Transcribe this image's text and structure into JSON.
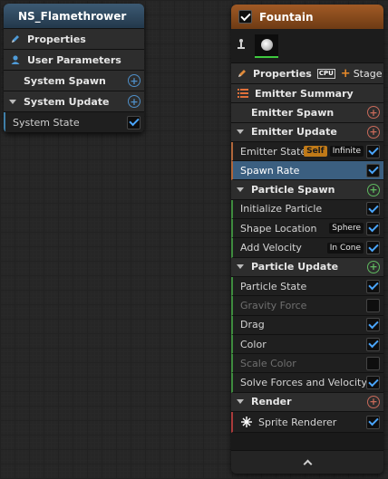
{
  "system_node": {
    "title": "NS_Flamethrower",
    "rows": {
      "properties": "Properties",
      "user_parameters": "User Parameters",
      "system_spawn": "System Spawn",
      "system_update": "System Update",
      "system_state": "System State"
    }
  },
  "emitter_node": {
    "title": "Fountain",
    "enabled": true,
    "properties_label": "Properties",
    "sim_target": "CPU",
    "stage_label": "Stage",
    "emitter_summary": "Emitter Summary",
    "emitter_spawn": "Emitter Spawn",
    "emitter_update": "Emitter Update",
    "emitter_state": {
      "label": "Emitter State",
      "tag1": "Self",
      "tag2": "Infinite",
      "checked": true
    },
    "spawn_rate": {
      "label": "Spawn Rate",
      "checked": true,
      "selected": true
    },
    "particle_spawn": "Particle Spawn",
    "initialize_particle": {
      "label": "Initialize Particle",
      "checked": true
    },
    "shape_location": {
      "label": "Shape Location",
      "tag": "Sphere",
      "checked": true
    },
    "add_velocity": {
      "label": "Add Velocity",
      "tag": "In Cone",
      "checked": true
    },
    "particle_update": "Particle Update",
    "particle_state": {
      "label": "Particle State",
      "checked": true
    },
    "gravity_force": {
      "label": "Gravity Force",
      "checked": false
    },
    "drag": {
      "label": "Drag",
      "checked": true
    },
    "color": {
      "label": "Color",
      "checked": true
    },
    "scale_color": {
      "label": "Scale Color",
      "checked": false
    },
    "solve_forces": {
      "label": "Solve Forces and Velocity",
      "checked": true
    },
    "render": "Render",
    "sprite_renderer": {
      "label": "Sprite Renderer",
      "checked": true
    }
  },
  "colors": {
    "system_header": "#3c5a73",
    "emitter_header": "#a15a25",
    "selection": "#3b5f80",
    "checkmark": "#4aa6ff"
  }
}
